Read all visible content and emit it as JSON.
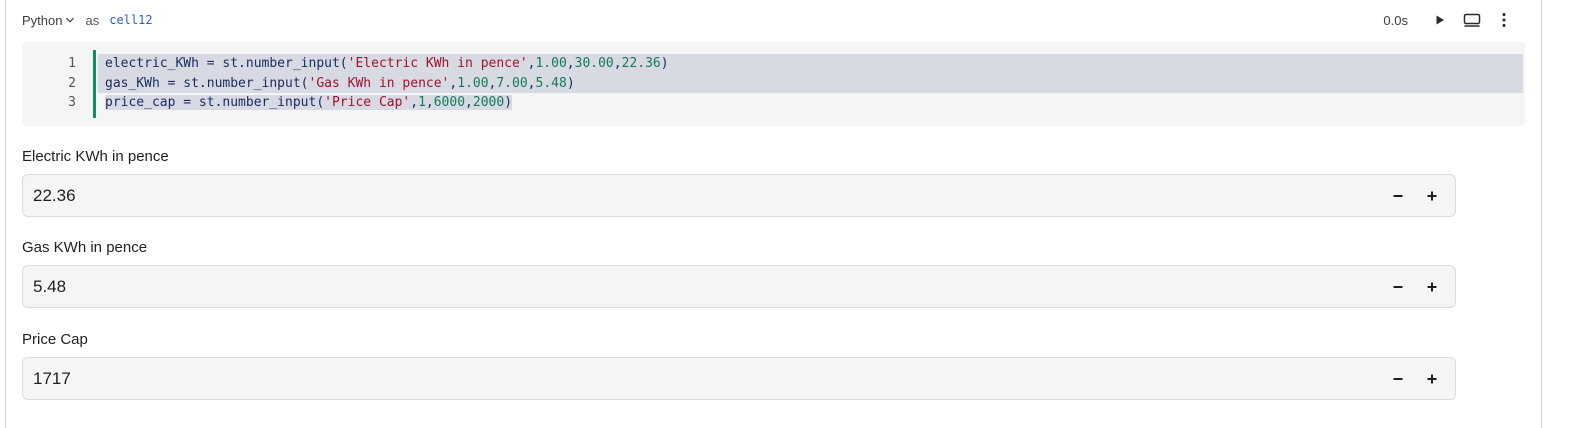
{
  "cell": {
    "language": "Python",
    "as_label": "as",
    "name": "cell12",
    "runtime": "0.0s"
  },
  "code": {
    "line_numbers": [
      "1",
      "2",
      "3"
    ],
    "lines": [
      [
        {
          "t": "electric_KWh = st.number_input(",
          "k": "plain"
        },
        {
          "t": "'Electric KWh in pence'",
          "k": "str"
        },
        {
          "t": ",",
          "k": "plain"
        },
        {
          "t": "1.00",
          "k": "num"
        },
        {
          "t": ",",
          "k": "plain"
        },
        {
          "t": "30.00",
          "k": "num"
        },
        {
          "t": ",",
          "k": "plain"
        },
        {
          "t": "22.36",
          "k": "num"
        },
        {
          "t": ")",
          "k": "plain"
        }
      ],
      [
        {
          "t": "gas_KWh = st.number_input(",
          "k": "plain"
        },
        {
          "t": "'Gas KWh in pence'",
          "k": "str"
        },
        {
          "t": ",",
          "k": "plain"
        },
        {
          "t": "1.00",
          "k": "num"
        },
        {
          "t": ",",
          "k": "plain"
        },
        {
          "t": "7.00",
          "k": "num"
        },
        {
          "t": ",",
          "k": "plain"
        },
        {
          "t": "5.48",
          "k": "num"
        },
        {
          "t": ")",
          "k": "plain"
        }
      ],
      [
        {
          "t": "price_cap = st.number_input(",
          "k": "plain"
        },
        {
          "t": "'Price Cap'",
          "k": "str"
        },
        {
          "t": ",",
          "k": "plain"
        },
        {
          "t": "1",
          "k": "num"
        },
        {
          "t": ",",
          "k": "plain"
        },
        {
          "t": "6000",
          "k": "num"
        },
        {
          "t": ",",
          "k": "plain"
        },
        {
          "t": "2000",
          "k": "num"
        },
        {
          "t": ")",
          "k": "plain"
        }
      ]
    ]
  },
  "widgets": [
    {
      "label": "Electric KWh in pence",
      "value": "22.36",
      "minus": "−",
      "plus": "+"
    },
    {
      "label": "Gas KWh in pence",
      "value": "5.48",
      "minus": "−",
      "plus": "+"
    },
    {
      "label": "Price Cap",
      "value": "1717",
      "minus": "−",
      "plus": "+"
    }
  ],
  "colors": {
    "accent_bar": "#0f8f5f",
    "string": "#a0122b",
    "number": "#157a5a",
    "cell_name": "#2e5fb8"
  },
  "icons": {
    "language_dropdown": "chevron-down-icon",
    "run": "play-icon",
    "display": "display-mode-icon",
    "more": "more-vertical-icon"
  }
}
